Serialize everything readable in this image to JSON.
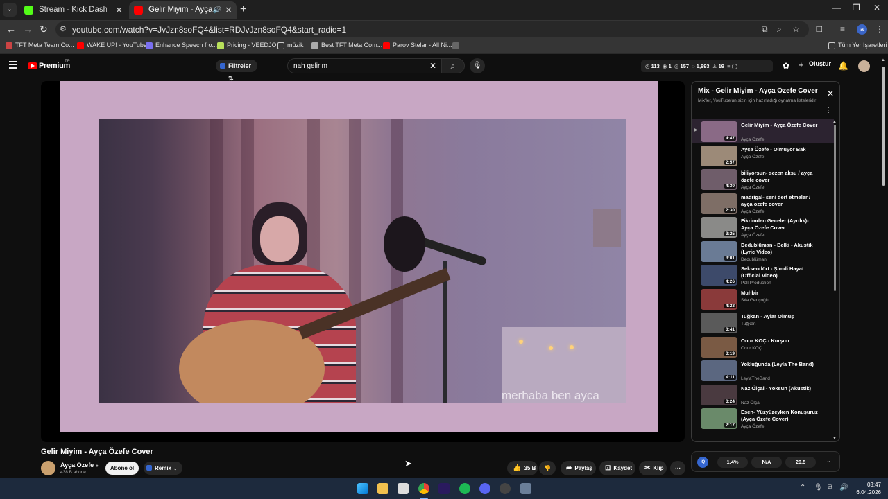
{
  "browser": {
    "tabs": [
      {
        "title": "Stream - Kick Dashboard",
        "favicon_color": "#53fc18",
        "active": false
      },
      {
        "title": "Gelir Miyim - Ayça Özefe Co",
        "favicon_color": "#ff0000",
        "active": true
      }
    ],
    "url": "youtube.com/watch?v=JvJzn8soFQ4&list=RDJvJzn8soFQ4&start_radio=1",
    "bookmarks": [
      {
        "label": "TFT Meta Team Co...",
        "icon_color": "#c44"
      },
      {
        "label": "WAKE UP! - YouTube",
        "icon_color": "#ff0000"
      },
      {
        "label": "Enhance Speech fro...",
        "icon_color": "#7a6ff0"
      },
      {
        "label": "Pricing - VEEDJO",
        "icon_color": "#b8e05a"
      },
      {
        "label": "müzik",
        "icon_color": "#888"
      },
      {
        "label": "Best TFT Meta Com...",
        "icon_color": "#aaa"
      },
      {
        "label": "Parov Stelar - All Ni...",
        "icon_color": "#ff0000"
      }
    ],
    "all_bookmarks": "Tüm Yer İşaretleri",
    "profile_letter": "a"
  },
  "header": {
    "logo_text": "Premium",
    "logo_sup": "TR",
    "filters_label": "Filtreler",
    "search_value": "nah gelirim",
    "stats": {
      "a": "113",
      "b": "1",
      "c": "157",
      "d": "1,693",
      "e": "19"
    },
    "create_label": "Oluştur"
  },
  "video": {
    "overlay_text": "merhaba ben ayca",
    "title": "Gelir Miyim - Ayça Özefe Cover",
    "channel": "Ayça Özefe",
    "subscribers": "438 B abone",
    "subscribe_label": "Abone ol",
    "remix_label": "Remix",
    "likes": "35 B",
    "share_label": "Paylaş",
    "save_label": "Kaydet",
    "clip_label": "Klip"
  },
  "playlist": {
    "title": "Mix - Gelir Miyim - Ayça Özefe Cover",
    "subtitle": "Mix'ler, YouTube'un sizin için hazırladığı oynatma listeleridir",
    "items": [
      {
        "title": "Gelir Miyim - Ayça Özefe Cover",
        "channel": "Ayça Özefe",
        "duration": "4:47",
        "thumb": "#8a6a86"
      },
      {
        "title": "Ayça Özefe - Olmuyor Bak",
        "channel": "Ayça Özefe",
        "duration": "2:57",
        "thumb": "#9c8a78"
      },
      {
        "title": "biliyorsun- sezen aksu / ayça özefe cover",
        "channel": "Ayça Özefe",
        "duration": "4:30",
        "thumb": "#6f5d6a"
      },
      {
        "title": "madrigal- seni dert etmeler / ayça ozefe cover",
        "channel": "Ayça Özefe",
        "duration": "2:30",
        "thumb": "#7e6e66"
      },
      {
        "title": "Fikrimden Geceler (Ayrılık)- Ayça Özefe Cover",
        "channel": "Ayça Özefe",
        "duration": "3:25",
        "thumb": "#8a8a88"
      },
      {
        "title": "Dedublüman - Belki - Akustik (Lyric Video)",
        "channel": "Dedublüman",
        "duration": "3:01",
        "thumb": "#6a7b95"
      },
      {
        "title": "Seksendört - Şimdi Hayat (Official Video)",
        "channel": "Poll Production",
        "duration": "4:26",
        "thumb": "#3d4a6a"
      },
      {
        "title": "Muhbir",
        "channel": "Sıla Gençoğlu",
        "duration": "4:23",
        "thumb": "#8a3a3a"
      },
      {
        "title": "Tuğkan - Aylar Olmuş",
        "channel": "Tuğkan",
        "duration": "3:41",
        "thumb": "#5a5a5a"
      },
      {
        "title": "Onur KOÇ - Kurşun",
        "channel": "Onur KOÇ",
        "duration": "3:19",
        "thumb": "#7a5a44"
      },
      {
        "title": "Yokluğunda (Leyla The Band)",
        "channel": "LeylaTheBand",
        "duration": "4:11",
        "thumb": "#5b6780"
      },
      {
        "title": "Naz Ölçal - Yoksun (Akustik)",
        "channel": "Naz Ölçal",
        "duration": "3:24",
        "thumb": "#4a3a40"
      },
      {
        "title": "Esen- Yüzyüzeyken Konuşuruz (Ayça Özefe Cover)",
        "channel": "Ayça Özefe",
        "duration": "2:17",
        "thumb": "#6a8a6a"
      }
    ]
  },
  "extension": {
    "v1": "1.4%",
    "v2": "N/A",
    "v3": "20.5"
  },
  "clock": {
    "time": "03:47",
    "date": "6.04.2026"
  }
}
